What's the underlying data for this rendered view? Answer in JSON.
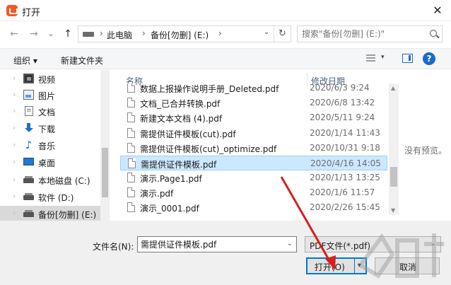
{
  "window": {
    "title": "打开",
    "close": "✕"
  },
  "nav_buttons": {
    "back": "←",
    "forward": "→",
    "recent": "⌄",
    "up": "↑"
  },
  "address": {
    "crumbs": [
      "此电脑",
      "备份[勿删] (E:)"
    ],
    "separator": "›",
    "refresh": "↻"
  },
  "search": {
    "placeholder": "搜索\"备份[勿删] (E:)\""
  },
  "toolbar": {
    "organize": "组织 ▾",
    "new_folder": "新建文件夹",
    "view_caret": "▾",
    "help": "?"
  },
  "sidebar": {
    "items": [
      {
        "label": "视频",
        "icon": "video-folder-icon"
      },
      {
        "label": "图片",
        "icon": "pictures-folder-icon"
      },
      {
        "label": "文档",
        "icon": "documents-folder-icon"
      },
      {
        "label": "下载",
        "icon": "downloads-folder-icon"
      },
      {
        "label": "音乐",
        "icon": "music-folder-icon"
      },
      {
        "label": "桌面",
        "icon": "desktop-folder-icon"
      },
      {
        "label": "本地磁盘 (C:)",
        "icon": "drive-icon"
      },
      {
        "label": "软件 (D:)",
        "icon": "drive-icon"
      },
      {
        "label": "备份[勿删] (E:)",
        "icon": "drive-icon"
      }
    ],
    "chevron": "›"
  },
  "file_list": {
    "columns": {
      "name": "名称",
      "date": "修改日期"
    },
    "rows": [
      {
        "name": "数据上报操作说明手册_Deleted.pdf",
        "date": "2020/6/3 9:24"
      },
      {
        "name": "文档_已合并转换.pdf",
        "date": "2020/6/8 13:42"
      },
      {
        "name": "新建文本文档 (4).pdf",
        "date": "2020/5/11 9:24"
      },
      {
        "name": "需提供证件模板(cut).pdf",
        "date": "2020/1/14 11:43"
      },
      {
        "name": "需提供证件模板(cut)_optimize.pdf",
        "date": "2020/10/31 9:18"
      },
      {
        "name": "需提供证件模板.pdf",
        "date": "2020/4/16 14:05"
      },
      {
        "name": "演示.Page1.pdf",
        "date": "2020/1/13 13:25"
      },
      {
        "name": "演示.pdf",
        "date": "2020/1/6 11:57"
      },
      {
        "name": "演示_0001.pdf",
        "date": "2020/2/26 15:45"
      }
    ],
    "selected_index": 5
  },
  "preview": {
    "text": "没有预览。"
  },
  "bottom": {
    "filename_label": "文件名(N):",
    "filename_value": "需提供证件模板.pdf",
    "filetype_value": "PDF文件(*.pdf)",
    "open_label": "打开(O)",
    "open_caret": "▾",
    "cancel_label": "取消",
    "dropdown": "⌄"
  },
  "colors": {
    "accent": "#0078d7",
    "selection": "#cce8ff",
    "arrow": "#d81e1e"
  }
}
